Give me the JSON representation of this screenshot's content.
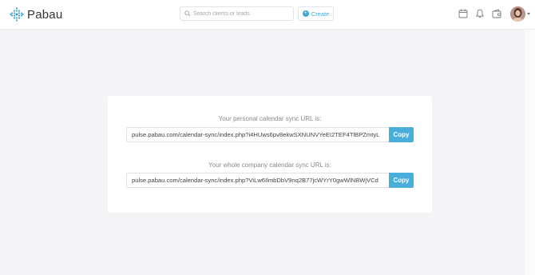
{
  "header": {
    "logo_text": "Pabau",
    "search_placeholder": "Search clients or leads",
    "create_label": "Create",
    "icons": [
      "calendar-icon",
      "bell-icon",
      "wallet-icon"
    ],
    "accent_color": "#3fa8d7"
  },
  "sync": {
    "personal_label": "Your personal calendar sync URL is:",
    "personal_url": "pulse.pabau.com/calendar-sync/index.php?i4HUws6pv8ekwSXNUNVYeEI2TEF4TlBPZmtyL",
    "company_label": "Your whole company calendar sync URL is:",
    "company_url": "pulse.pabau.com/calendar-sync/index.php?ViLw6IlmbDbV9nq2B77jcWYrY0gwWlNBWjVCd",
    "copy_label": "Copy"
  }
}
